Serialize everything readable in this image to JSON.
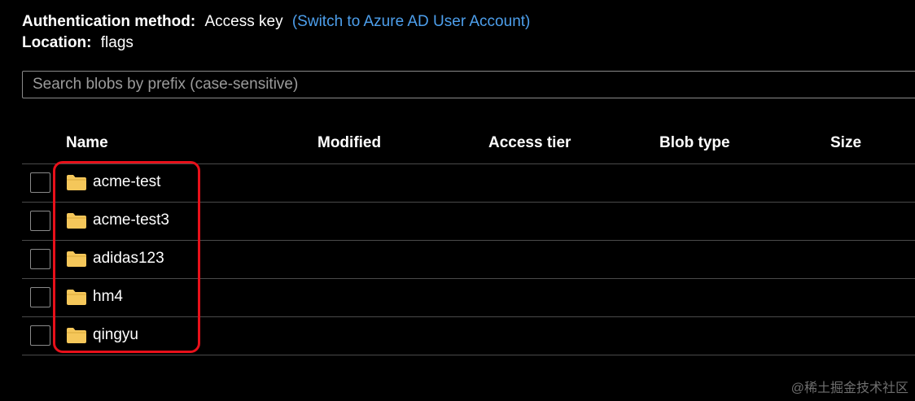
{
  "info": {
    "auth_label": "Authentication method:",
    "auth_value": "Access key",
    "auth_switch_link": "(Switch to Azure AD User Account)",
    "location_label": "Location:",
    "location_value": "flags"
  },
  "search": {
    "placeholder": "Search blobs by prefix (case-sensitive)"
  },
  "table": {
    "columns": {
      "name": "Name",
      "modified": "Modified",
      "access_tier": "Access tier",
      "blob_type": "Blob type",
      "size": "Size"
    },
    "rows": [
      {
        "name": "acme-test",
        "icon": "folder-icon"
      },
      {
        "name": "acme-test3",
        "icon": "folder-icon"
      },
      {
        "name": "adidas123",
        "icon": "folder-icon"
      },
      {
        "name": "hm4",
        "icon": "folder-icon"
      },
      {
        "name": "qingyu",
        "icon": "folder-icon"
      }
    ]
  },
  "watermark": "@稀土掘金技术社区",
  "colors": {
    "background": "#000000",
    "link": "#4d9fec",
    "folder": "#f5c75a",
    "highlight": "#e8101a",
    "divider": "#4a4a4a"
  }
}
